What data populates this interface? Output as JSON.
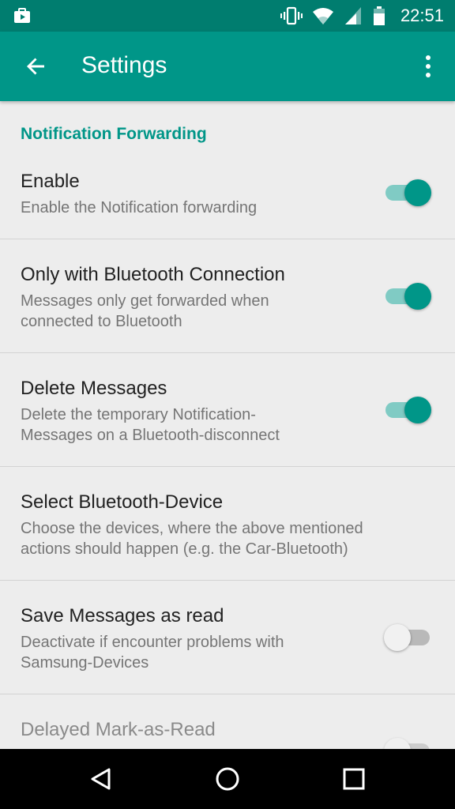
{
  "status_bar": {
    "time": "22:51",
    "icons": [
      "notification-app-icon",
      "vibrate-icon",
      "wifi-icon",
      "cell-signal-icon",
      "battery-icon"
    ]
  },
  "app_bar": {
    "title": "Settings",
    "back_icon": "arrow-back-icon",
    "menu_icon": "more-vert-icon"
  },
  "section": {
    "title": "Notification Forwarding"
  },
  "preferences": [
    {
      "title": "Enable",
      "summary": "Enable the Notification forwarding",
      "enabled": true
    },
    {
      "title": "Only with Bluetooth Connection",
      "summary": "Messages only get forwarded when connected to Bluetooth",
      "enabled": true
    },
    {
      "title": "Delete Messages",
      "summary": "Delete the temporary Notification-Messages on a Bluetooth-disconnect",
      "enabled": true
    },
    {
      "title": "Select Bluetooth-Device",
      "summary": "Choose the devices, where the above mentioned actions should happen (e.g. the Car-Bluetooth)"
    },
    {
      "title": "Save Messages as read",
      "summary": "Deactivate if encounter problems with Samsung-Devices",
      "enabled": false
    },
    {
      "title": "Delayed Mark-as-Read",
      "enabled": false
    }
  ],
  "colors": {
    "accent": "#009688",
    "status_bar": "#007d6f",
    "track_on": "#80cbc4",
    "track_off": "#b9b9b9",
    "thumb_off": "#f1f1f1"
  },
  "nav_bar": {
    "icons": [
      "back-triangle-icon",
      "home-circle-icon",
      "recents-square-icon"
    ]
  }
}
